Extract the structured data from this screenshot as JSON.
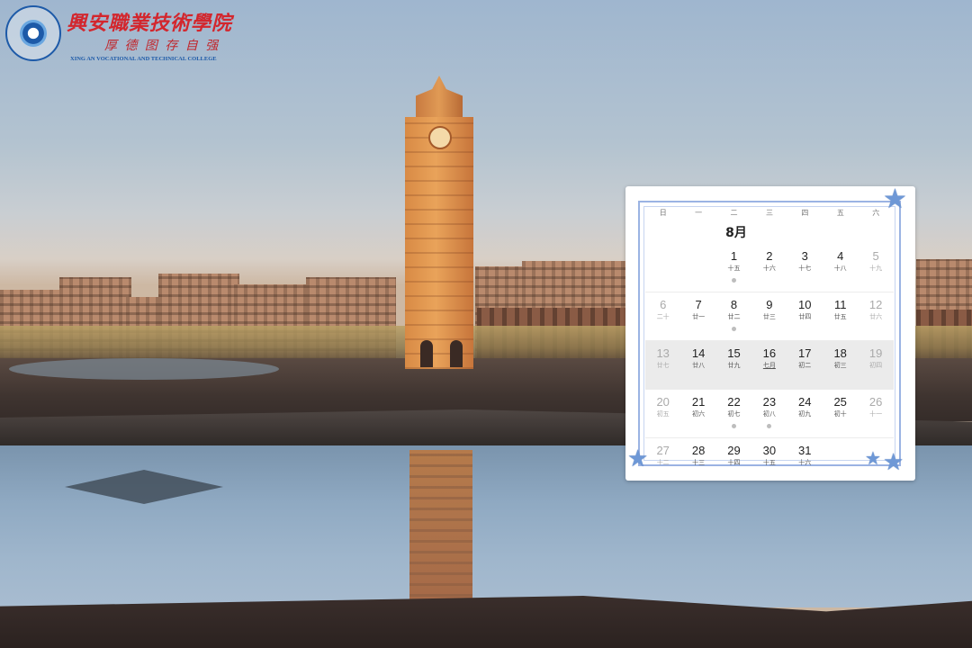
{
  "logo": {
    "name_cn": "興安職業技術學院",
    "motto": "厚 德 图 存 自 强",
    "name_en": "XING AN VOCATIONAL AND TECHNICAL COLLEGE"
  },
  "calendar": {
    "weekdays": [
      "日",
      "一",
      "二",
      "三",
      "四",
      "五",
      "六"
    ],
    "month_label": "8月",
    "accent_color": "#9bb3e3",
    "weeks": [
      [
        {
          "day": "",
          "lunar": ""
        },
        {
          "day": "",
          "lunar": ""
        },
        {
          "day": "",
          "lunar": ""
        },
        {
          "day": "1",
          "lunar": "十五",
          "dot": true
        },
        {
          "day": "2",
          "lunar": "十六"
        },
        {
          "day": "3",
          "lunar": "十七"
        },
        {
          "day": "4",
          "lunar": "十八"
        },
        {
          "day": "5",
          "lunar": "十九"
        }
      ],
      [
        {
          "day": "6",
          "lunar": "二十"
        },
        {
          "day": "7",
          "lunar": "廿一"
        },
        {
          "day": "8",
          "lunar": "廿二",
          "dot": true
        },
        {
          "day": "9",
          "lunar": "廿三"
        },
        {
          "day": "10",
          "lunar": "廿四"
        },
        {
          "day": "11",
          "lunar": "廿五"
        },
        {
          "day": "12",
          "lunar": "廿六"
        }
      ],
      [
        {
          "day": "13",
          "lunar": "廿七"
        },
        {
          "day": "14",
          "lunar": "廿八"
        },
        {
          "day": "15",
          "lunar": "廿九"
        },
        {
          "day": "16",
          "lunar": "七月"
        },
        {
          "day": "17",
          "lunar": "初二"
        },
        {
          "day": "18",
          "lunar": "初三"
        },
        {
          "day": "19",
          "lunar": "初四"
        }
      ],
      [
        {
          "day": "20",
          "lunar": "初五"
        },
        {
          "day": "21",
          "lunar": "初六"
        },
        {
          "day": "22",
          "lunar": "初七",
          "dot": true
        },
        {
          "day": "23",
          "lunar": "初八",
          "dot": true
        },
        {
          "day": "24",
          "lunar": "初九"
        },
        {
          "day": "25",
          "lunar": "初十"
        },
        {
          "day": "26",
          "lunar": "十一"
        }
      ],
      [
        {
          "day": "27",
          "lunar": "十二"
        },
        {
          "day": "28",
          "lunar": "十三"
        },
        {
          "day": "29",
          "lunar": "十四"
        },
        {
          "day": "30",
          "lunar": "十五"
        },
        {
          "day": "31",
          "lunar": "十六"
        }
      ]
    ]
  },
  "icons": {
    "decor": "star-icon"
  }
}
